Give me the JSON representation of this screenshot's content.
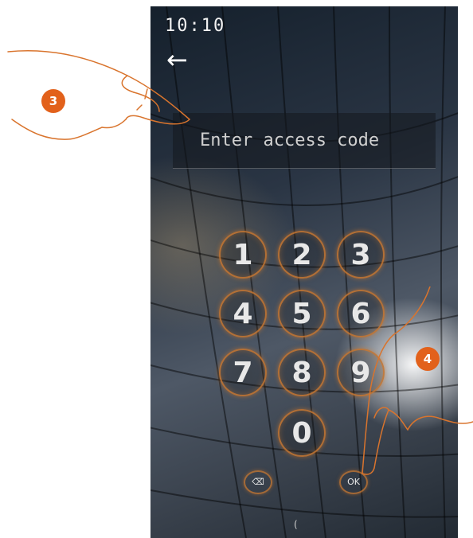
{
  "status_bar": {
    "time": "10:10"
  },
  "nav": {
    "back_icon": "arrow-left-icon",
    "back_glyph": "←"
  },
  "code_input": {
    "placeholder": "Enter access code"
  },
  "keypad": {
    "keys": [
      "1",
      "2",
      "3",
      "4",
      "5",
      "6",
      "7",
      "8",
      "9",
      "0"
    ],
    "delete_label": "⌫",
    "ok_label": "OK"
  },
  "callouts": {
    "step_3": "3",
    "step_4": "4"
  },
  "colors": {
    "accent": "#e2611b",
    "key_ring": "#c8783a"
  },
  "bottom": {
    "indicator": "("
  }
}
